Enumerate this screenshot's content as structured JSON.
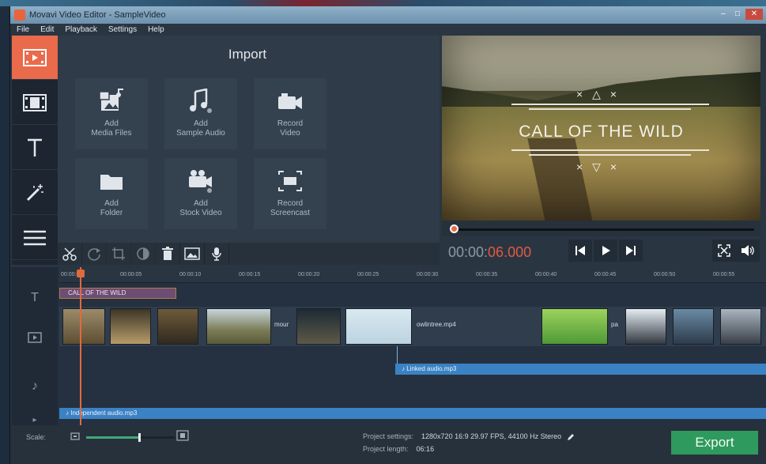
{
  "window": {
    "title": "Movavi Video Editor - SampleVideo"
  },
  "menu": [
    "File",
    "Edit",
    "Playback",
    "Settings",
    "Help"
  ],
  "import": {
    "title": "Import",
    "tiles": [
      {
        "label": "Add\nMedia Files",
        "icon": "media-files-icon"
      },
      {
        "label": "Add\nSample Audio",
        "icon": "music-note-icon"
      },
      {
        "label": "Record\nVideo",
        "icon": "camera-icon"
      },
      {
        "label": "Add\nFolder",
        "icon": "folder-icon"
      },
      {
        "label": "Add\nStock Video",
        "icon": "stock-video-icon"
      },
      {
        "label": "Record\nScreencast",
        "icon": "screencast-icon"
      }
    ]
  },
  "preview": {
    "title_text": "CALL OF THE WILD",
    "marks_top": "×△×",
    "marks_bottom": "×▽×"
  },
  "player": {
    "time_gray": "00:00:",
    "time_red": "06.000"
  },
  "ruler": [
    "00:00:00",
    "00:00:05",
    "00:00:10",
    "00:00:15",
    "00:00:20",
    "00:00:25",
    "00:00:30",
    "00:00:35",
    "00:00:40",
    "00:00:45",
    "00:00:50",
    "00:00:55"
  ],
  "timeline": {
    "title_clip": "CALL OF THE WILD",
    "clip_name_1": "mour",
    "clip_name_2": "owlintree.mp4",
    "clip_name_3": "pa",
    "linked_audio": "♪ Linked audio.mp3",
    "independent_audio": "♪ Independent audio.mp3"
  },
  "status": {
    "scale_label": "Scale:",
    "scale_value": 0.6,
    "project_settings_label": "Project settings:",
    "project_settings_value": "1280x720 16:9 29.97 FPS, 44100 Hz Stereo",
    "project_length_label": "Project length:",
    "project_length_value": "06:16"
  },
  "export_label": "Export",
  "colors": {
    "accent": "#ea6a4c",
    "export": "#2f9a5d",
    "audio": "#3b82c4"
  }
}
